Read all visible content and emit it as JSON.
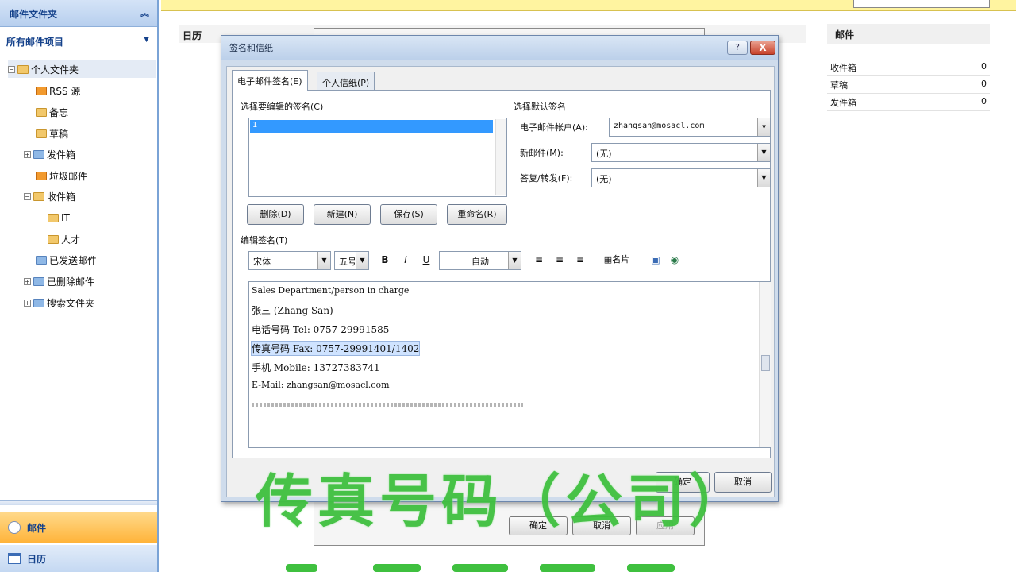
{
  "nav": {
    "header": "邮件文件夹",
    "all_items": "所有邮件项目",
    "tree": [
      {
        "label": "个人文件夹"
      },
      {
        "label": "RSS 源"
      },
      {
        "label": "备忘"
      },
      {
        "label": "草稿"
      },
      {
        "label": "发件箱"
      },
      {
        "label": "垃圾邮件"
      },
      {
        "label": "收件箱"
      },
      {
        "label": "IT"
      },
      {
        "label": "人才"
      },
      {
        "label": "已发送邮件"
      },
      {
        "label": "已删除邮件"
      },
      {
        "label": "搜索文件夹"
      }
    ],
    "mail_button": "邮件",
    "calendar_button": "日历"
  },
  "main": {
    "calendar_label": "日历",
    "right_pane": {
      "title": "邮件",
      "rows": [
        {
          "label": "收件箱",
          "count": "0"
        },
        {
          "label": "草稿",
          "count": "0"
        },
        {
          "label": "发件箱",
          "count": "0"
        }
      ]
    }
  },
  "background_dialog": {
    "ok": "确定",
    "cancel": "取消",
    "apply": "应用"
  },
  "dialog": {
    "title": "签名和信纸",
    "help": "?",
    "close": "X",
    "tabs": [
      "电子邮件签名(E)",
      "个人信纸(P)"
    ],
    "select_signature_label": "选择要编辑的签名(C)",
    "signature_list": [
      "1"
    ],
    "buttons": {
      "delete": "删除(D)",
      "new": "新建(N)",
      "save": "保存(S)",
      "rename": "重命名(R)"
    },
    "default_signature_label": "选择默认签名",
    "account_label": "电子邮件帐户(A):",
    "account_value": "zhangsan@mosacl.com",
    "new_message_label": "新邮件(M):",
    "new_message_value": "(无)",
    "reply_label": "答复/转发(F):",
    "reply_value": "(无)",
    "edit_signature_label": "编辑签名(T)",
    "font_name": "宋体",
    "font_size": "五号",
    "bold": "B",
    "italic": "I",
    "underline": "U",
    "color": "自动",
    "business_card": "名片",
    "signature_lines": [
      "Sales Department/person in charge",
      "张三 (Zhang San)",
      "电话号码 Tel: 0757-29991585",
      "传真号码 Fax: 0757-29991401/1402",
      "手机 Mobile: 13727383741",
      "E-Mail: zhangsan@mosacl.com"
    ],
    "ok": "确定",
    "cancel": "取消"
  },
  "caption": "传真号码（公司）"
}
